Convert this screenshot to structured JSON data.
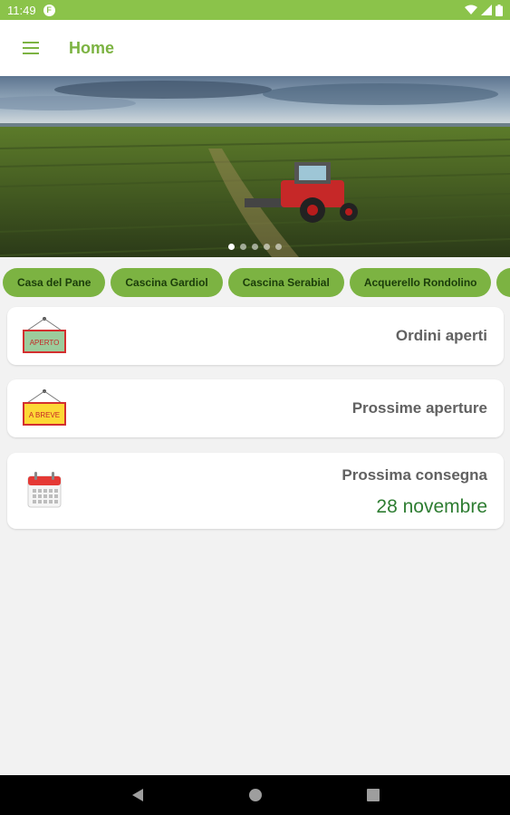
{
  "status_bar": {
    "time": "11:49",
    "app_badge": "F"
  },
  "app_bar": {
    "title": "Home"
  },
  "banner": {
    "slide_count": 5,
    "active_index": 0
  },
  "chips": [
    {
      "label": "Casa del Pane"
    },
    {
      "label": "Cascina Gardiol"
    },
    {
      "label": "Cascina Serabial"
    },
    {
      "label": "Acquerello Rondolino"
    },
    {
      "label": ""
    }
  ],
  "cards": {
    "open_orders": {
      "label": "Ordini aperti",
      "sign_text": "APERTO"
    },
    "upcoming": {
      "label": "Prossime aperture",
      "sign_text": "A BREVE"
    },
    "next_delivery": {
      "label": "Prossima consegna",
      "date": "28 novembre"
    }
  },
  "colors": {
    "status_bar": "#8bc34a",
    "accent": "#7cb342",
    "chip_text": "#1b3d0a",
    "date_text": "#2e7d32"
  }
}
